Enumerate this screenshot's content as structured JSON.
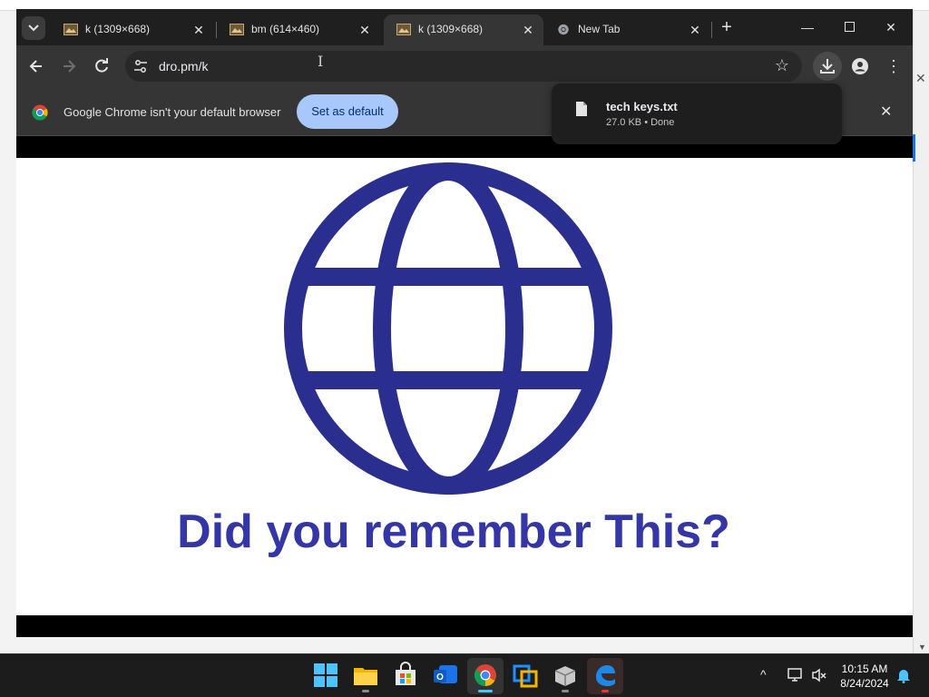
{
  "tabs": [
    {
      "title": "k (1309×668)",
      "active": false
    },
    {
      "title": "bm (614×460)",
      "active": false
    },
    {
      "title": "k (1309×668)",
      "active": true
    },
    {
      "title": "New Tab",
      "active": false
    }
  ],
  "toolbar": {
    "url": "dro.pm/k"
  },
  "infobar": {
    "message": "Google Chrome isn't your default browser",
    "button_label": "Set as default"
  },
  "download": {
    "filename": "tech keys.txt",
    "meta": "27.0 KB • Done"
  },
  "page": {
    "headline": "Did you remember This?"
  },
  "taskbar": {
    "time": "10:15 AM",
    "date": "8/24/2024"
  },
  "colors": {
    "globe": "#2a2f8f",
    "headline": "#3436a6",
    "accent_button": "#a8c7fa"
  }
}
